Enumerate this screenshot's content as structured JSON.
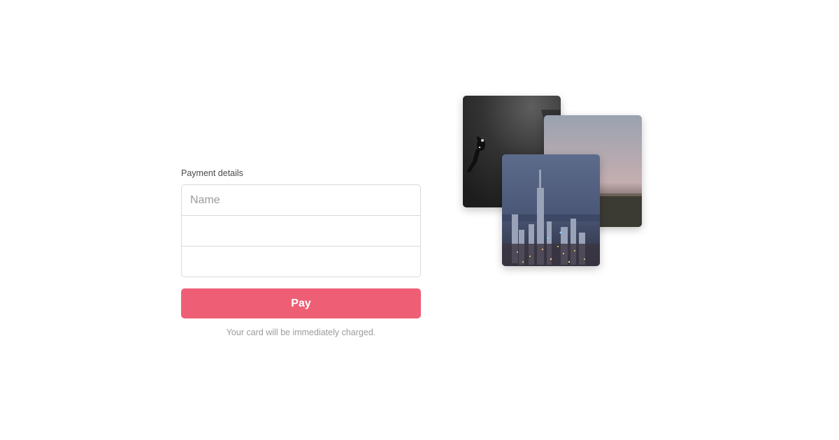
{
  "payment": {
    "label": "Payment details",
    "fields": {
      "name_placeholder": "Name",
      "card_placeholder": "",
      "extra_placeholder": ""
    },
    "pay_label": "Pay",
    "note": "Your card will be immediately charged."
  },
  "colors": {
    "accent": "#ee5f76"
  },
  "photos": [
    {
      "subject": "scuba diver in dark water"
    },
    {
      "subject": "dusk horizon over plains"
    },
    {
      "subject": "city skyline at night"
    }
  ]
}
